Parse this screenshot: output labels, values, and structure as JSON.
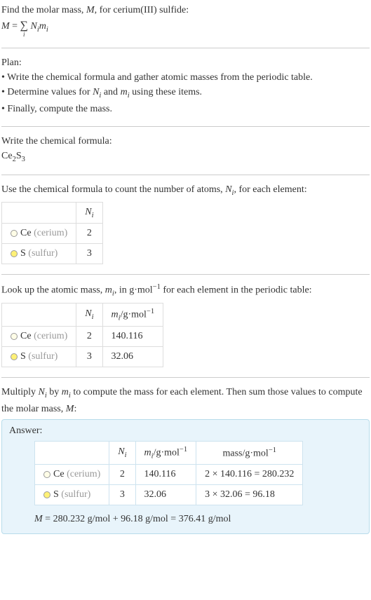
{
  "intro": {
    "line1_a": "Find the molar mass, ",
    "line1_M": "M",
    "line1_b": ", for cerium(III) sulfide:",
    "eq_M": "M",
    "eq_eq": " = ",
    "eq_sigma": "∑",
    "eq_sigma_sub": "i",
    "eq_rhs_a": " N",
    "eq_rhs_ai": "i",
    "eq_rhs_b": "m",
    "eq_rhs_bi": "i"
  },
  "plan": {
    "title": "Plan:",
    "b1": "• Write the chemical formula and gather atomic masses from the periodic table.",
    "b2_a": "• Determine values for ",
    "b2_N": "N",
    "b2_i1": "i",
    "b2_and": " and ",
    "b2_m": "m",
    "b2_i2": "i",
    "b2_b": " using these items.",
    "b3": "• Finally, compute the mass."
  },
  "formula": {
    "title": "Write the chemical formula:",
    "ce": "Ce",
    "ce_n": "2",
    "s": "S",
    "s_n": "3"
  },
  "count": {
    "title_a": "Use the chemical formula to count the number of atoms, ",
    "title_N": "N",
    "title_i": "i",
    "title_b": ", for each element:",
    "h_Ni_a": "N",
    "h_Ni_i": "i",
    "ce_label": "Ce",
    "ce_paren": " (cerium)",
    "ce_n": "2",
    "s_label": "S",
    "s_paren": " (sulfur)",
    "s_n": "3"
  },
  "lookup": {
    "title_a": "Look up the atomic mass, ",
    "title_m": "m",
    "title_i": "i",
    "title_b": ", in g·mol",
    "title_exp": "−1",
    "title_c": " for each element in the periodic table:",
    "h_Ni_a": "N",
    "h_Ni_i": "i",
    "h_mi_a": "m",
    "h_mi_i": "i",
    "h_mi_u": "/g·mol",
    "h_mi_exp": "−1",
    "ce_label": "Ce",
    "ce_paren": " (cerium)",
    "ce_n": "2",
    "ce_m": "140.116",
    "s_label": "S",
    "s_paren": " (sulfur)",
    "s_n": "3",
    "s_m": "32.06"
  },
  "compute": {
    "title_a": "Multiply ",
    "title_N": "N",
    "title_i1": "i",
    "title_by": " by ",
    "title_m": "m",
    "title_i2": "i",
    "title_b": " to compute the mass for each element. Then sum those values to compute the molar mass, ",
    "title_M": "M",
    "title_c": ":"
  },
  "answer": {
    "label": "Answer:",
    "h_Ni_a": "N",
    "h_Ni_i": "i",
    "h_mi_a": "m",
    "h_mi_i": "i",
    "h_mi_u": "/g·mol",
    "h_mi_exp": "−1",
    "h_mass": "mass/g·mol",
    "h_mass_exp": "−1",
    "ce_label": "Ce",
    "ce_paren": " (cerium)",
    "ce_n": "2",
    "ce_m": "140.116",
    "ce_mass": "2 × 140.116 = 280.232",
    "s_label": "S",
    "s_paren": " (sulfur)",
    "s_n": "3",
    "s_m": "32.06",
    "s_mass": "3 × 32.06 = 96.18",
    "final_M": "M",
    "final_rest": " = 280.232 g/mol + 96.18 g/mol = 376.41 g/mol"
  }
}
